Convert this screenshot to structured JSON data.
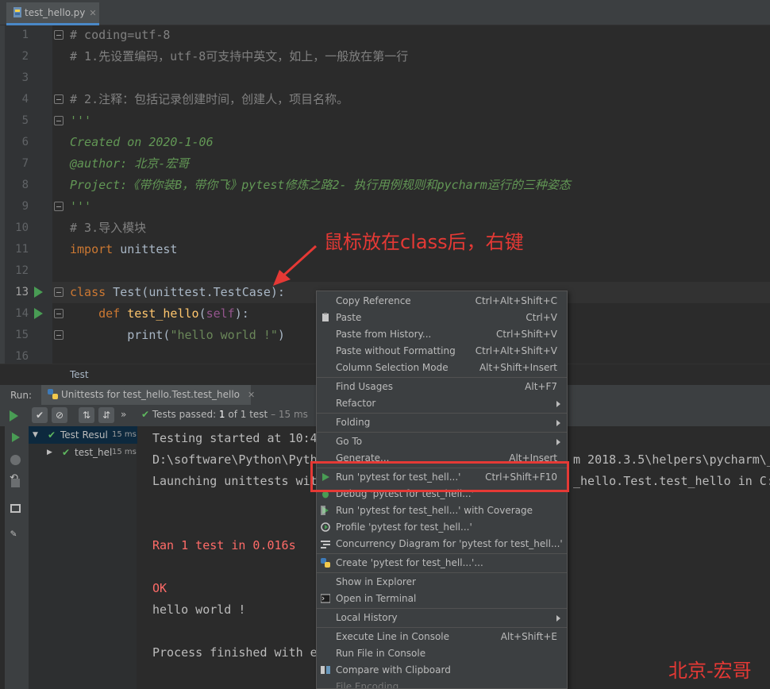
{
  "editor_tab": {
    "filename": "test_hello.py",
    "close": "✕"
  },
  "code_lines": [
    {
      "num": "1",
      "parts": [
        {
          "t": "# coding=utf-8",
          "c": "comment"
        }
      ]
    },
    {
      "num": "2",
      "parts": [
        {
          "t": "# 1.先设置编码，utf-8可支持中英文，如上，一般放在第一行",
          "c": "comment"
        }
      ]
    },
    {
      "num": "3",
      "parts": []
    },
    {
      "num": "4",
      "parts": [
        {
          "t": "# 2.注释：包括记录创建时间，创建人，项目名称。",
          "c": "comment"
        }
      ]
    },
    {
      "num": "5",
      "parts": [
        {
          "t": "'''",
          "c": "doc"
        }
      ]
    },
    {
      "num": "6",
      "parts": [
        {
          "t": "Created on 2020-1-06",
          "c": "doc"
        }
      ]
    },
    {
      "num": "7",
      "parts": [
        {
          "t": "@author: 北京-宏哥",
          "c": "doc"
        }
      ]
    },
    {
      "num": "8",
      "parts": [
        {
          "t": "Project:《带你装B，带你飞》pytest修炼之路2- 执行用例规则和pycharm运行的三种姿态",
          "c": "doc"
        }
      ]
    },
    {
      "num": "9",
      "parts": [
        {
          "t": "'''",
          "c": "doc"
        }
      ]
    },
    {
      "num": "10",
      "parts": [
        {
          "t": "# 3.导入模块",
          "c": "comment"
        }
      ]
    },
    {
      "num": "11",
      "parts": [
        {
          "t": "import",
          "c": "kw"
        },
        {
          "t": " unittest",
          "c": "plain"
        }
      ]
    },
    {
      "num": "12",
      "parts": []
    },
    {
      "num": "13",
      "parts": [
        {
          "t": "class",
          "c": "kw"
        },
        {
          "t": " Test(unittest.TestCase):",
          "c": "plain"
        }
      ]
    },
    {
      "num": "14",
      "parts": [
        {
          "t": "    ",
          "c": "plain"
        },
        {
          "t": "def",
          "c": "kw"
        },
        {
          "t": " ",
          "c": "plain"
        },
        {
          "t": "test_hello",
          "c": "fn"
        },
        {
          "t": "(",
          "c": "plain"
        },
        {
          "t": "self",
          "c": "self"
        },
        {
          "t": "):",
          "c": "plain"
        }
      ]
    },
    {
      "num": "15",
      "parts": [
        {
          "t": "        print(",
          "c": "plain"
        },
        {
          "t": "\"hello world !\"",
          "c": "str"
        },
        {
          "t": ")",
          "c": "plain"
        }
      ]
    },
    {
      "num": "16",
      "parts": []
    }
  ],
  "breadcrumb": "Test",
  "annotation": "鼠标放在class后，右键",
  "run_panel": {
    "label": "Run:",
    "tab_title": "Unittests for test_hello.Test.test_hello",
    "tab_close": "✕",
    "status_prefix": "Tests passed: ",
    "status_count": "1",
    "status_suffix": " of 1 test",
    "status_time": " – 15 ms",
    "tree": [
      {
        "label": "Test Resul",
        "time": "15 ms"
      },
      {
        "label": "test_hel",
        "time": "15 ms"
      }
    ],
    "console": [
      {
        "text": "Testing started at 10:4",
        "err": false
      },
      {
        "text": "D:\\software\\Python\\Pyth",
        "err": false
      },
      {
        "text": "Launching unittests wit",
        "err": false
      },
      {
        "text": "",
        "err": false
      },
      {
        "text": "",
        "err": false
      },
      {
        "text": "Ran 1 test in 0.016s",
        "err": true
      },
      {
        "text": "",
        "err": false
      },
      {
        "text": "OK",
        "err": true
      },
      {
        "text": "hello world !",
        "err": false
      },
      {
        "text": "",
        "err": false
      },
      {
        "text": "Process finished with e",
        "err": false
      }
    ],
    "console_right": [
      {
        "text": "m 2018.3.5\\helpers\\pycharm\\_",
        "line": 1
      },
      {
        "text": "_hello.Test.test_hello in C:\\",
        "line": 2
      }
    ]
  },
  "context_menu": [
    {
      "label": "Copy Reference",
      "shortcut": "Ctrl+Alt+Shift+C"
    },
    {
      "label": "Paste",
      "shortcut": "Ctrl+V",
      "icon": "clipboard"
    },
    {
      "label": "Paste from History...",
      "shortcut": "Ctrl+Shift+V"
    },
    {
      "label": "Paste without Formatting",
      "shortcut": "Ctrl+Alt+Shift+V"
    },
    {
      "label": "Column Selection Mode",
      "shortcut": "Alt+Shift+Insert"
    },
    {
      "sep": true
    },
    {
      "label": "Find Usages",
      "shortcut": "Alt+F7"
    },
    {
      "label": "Refactor",
      "submenu": true
    },
    {
      "sep": true
    },
    {
      "label": "Folding",
      "submenu": true
    },
    {
      "sep": true
    },
    {
      "label": "Go To",
      "submenu": true
    },
    {
      "label": "Generate...",
      "shortcut": "Alt+Insert"
    },
    {
      "sep": true
    },
    {
      "label": "Run 'pytest for test_hell...'",
      "shortcut": "Ctrl+Shift+F10",
      "icon": "run"
    },
    {
      "label": "Debug 'pytest for test_hell...'",
      "icon": "debug"
    },
    {
      "label": "Run 'pytest for test_hell...' with Coverage",
      "icon": "coverage"
    },
    {
      "label": "Profile 'pytest for test_hell...'",
      "icon": "profile"
    },
    {
      "label": "Concurrency Diagram for 'pytest for test_hell...'",
      "icon": "diagram"
    },
    {
      "sep": true
    },
    {
      "label": "Create 'pytest for test_hell...'...",
      "icon": "python"
    },
    {
      "sep": true
    },
    {
      "label": "Show in Explorer"
    },
    {
      "label": "Open in Terminal",
      "icon": "terminal"
    },
    {
      "sep": true
    },
    {
      "label": "Local History",
      "submenu": true
    },
    {
      "sep": true
    },
    {
      "label": "Execute Line in Console",
      "shortcut": "Alt+Shift+E"
    },
    {
      "label": "Run File in Console"
    },
    {
      "label": "Compare with Clipboard",
      "icon": "compare"
    },
    {
      "label": "File Encoding",
      "dim": true
    }
  ],
  "watermark": "北京-宏哥",
  "colors": {
    "accent_red": "#e53935",
    "run_green": "#499c54",
    "tab_underline": "#4a88c7"
  }
}
